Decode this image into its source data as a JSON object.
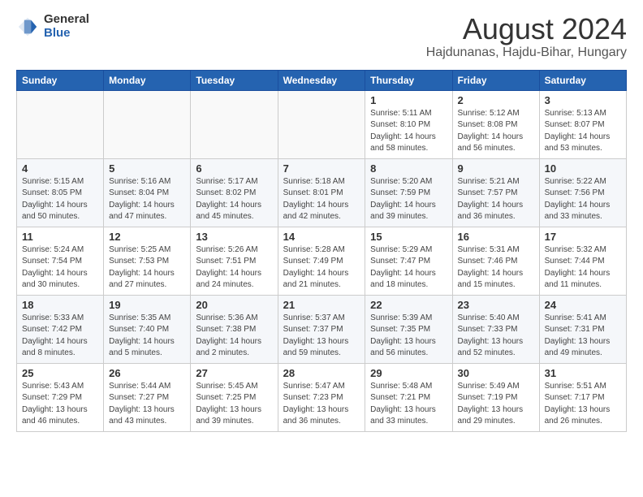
{
  "header": {
    "logo_general": "General",
    "logo_blue": "Blue",
    "month_title": "August 2024",
    "location": "Hajdunanas, Hajdu-Bihar, Hungary"
  },
  "weekdays": [
    "Sunday",
    "Monday",
    "Tuesday",
    "Wednesday",
    "Thursday",
    "Friday",
    "Saturday"
  ],
  "weeks": [
    [
      {
        "day": "",
        "info": ""
      },
      {
        "day": "",
        "info": ""
      },
      {
        "day": "",
        "info": ""
      },
      {
        "day": "",
        "info": ""
      },
      {
        "day": "1",
        "info": "Sunrise: 5:11 AM\nSunset: 8:10 PM\nDaylight: 14 hours and 58 minutes."
      },
      {
        "day": "2",
        "info": "Sunrise: 5:12 AM\nSunset: 8:08 PM\nDaylight: 14 hours and 56 minutes."
      },
      {
        "day": "3",
        "info": "Sunrise: 5:13 AM\nSunset: 8:07 PM\nDaylight: 14 hours and 53 minutes."
      }
    ],
    [
      {
        "day": "4",
        "info": "Sunrise: 5:15 AM\nSunset: 8:05 PM\nDaylight: 14 hours and 50 minutes."
      },
      {
        "day": "5",
        "info": "Sunrise: 5:16 AM\nSunset: 8:04 PM\nDaylight: 14 hours and 47 minutes."
      },
      {
        "day": "6",
        "info": "Sunrise: 5:17 AM\nSunset: 8:02 PM\nDaylight: 14 hours and 45 minutes."
      },
      {
        "day": "7",
        "info": "Sunrise: 5:18 AM\nSunset: 8:01 PM\nDaylight: 14 hours and 42 minutes."
      },
      {
        "day": "8",
        "info": "Sunrise: 5:20 AM\nSunset: 7:59 PM\nDaylight: 14 hours and 39 minutes."
      },
      {
        "day": "9",
        "info": "Sunrise: 5:21 AM\nSunset: 7:57 PM\nDaylight: 14 hours and 36 minutes."
      },
      {
        "day": "10",
        "info": "Sunrise: 5:22 AM\nSunset: 7:56 PM\nDaylight: 14 hours and 33 minutes."
      }
    ],
    [
      {
        "day": "11",
        "info": "Sunrise: 5:24 AM\nSunset: 7:54 PM\nDaylight: 14 hours and 30 minutes."
      },
      {
        "day": "12",
        "info": "Sunrise: 5:25 AM\nSunset: 7:53 PM\nDaylight: 14 hours and 27 minutes."
      },
      {
        "day": "13",
        "info": "Sunrise: 5:26 AM\nSunset: 7:51 PM\nDaylight: 14 hours and 24 minutes."
      },
      {
        "day": "14",
        "info": "Sunrise: 5:28 AM\nSunset: 7:49 PM\nDaylight: 14 hours and 21 minutes."
      },
      {
        "day": "15",
        "info": "Sunrise: 5:29 AM\nSunset: 7:47 PM\nDaylight: 14 hours and 18 minutes."
      },
      {
        "day": "16",
        "info": "Sunrise: 5:31 AM\nSunset: 7:46 PM\nDaylight: 14 hours and 15 minutes."
      },
      {
        "day": "17",
        "info": "Sunrise: 5:32 AM\nSunset: 7:44 PM\nDaylight: 14 hours and 11 minutes."
      }
    ],
    [
      {
        "day": "18",
        "info": "Sunrise: 5:33 AM\nSunset: 7:42 PM\nDaylight: 14 hours and 8 minutes."
      },
      {
        "day": "19",
        "info": "Sunrise: 5:35 AM\nSunset: 7:40 PM\nDaylight: 14 hours and 5 minutes."
      },
      {
        "day": "20",
        "info": "Sunrise: 5:36 AM\nSunset: 7:38 PM\nDaylight: 14 hours and 2 minutes."
      },
      {
        "day": "21",
        "info": "Sunrise: 5:37 AM\nSunset: 7:37 PM\nDaylight: 13 hours and 59 minutes."
      },
      {
        "day": "22",
        "info": "Sunrise: 5:39 AM\nSunset: 7:35 PM\nDaylight: 13 hours and 56 minutes."
      },
      {
        "day": "23",
        "info": "Sunrise: 5:40 AM\nSunset: 7:33 PM\nDaylight: 13 hours and 52 minutes."
      },
      {
        "day": "24",
        "info": "Sunrise: 5:41 AM\nSunset: 7:31 PM\nDaylight: 13 hours and 49 minutes."
      }
    ],
    [
      {
        "day": "25",
        "info": "Sunrise: 5:43 AM\nSunset: 7:29 PM\nDaylight: 13 hours and 46 minutes."
      },
      {
        "day": "26",
        "info": "Sunrise: 5:44 AM\nSunset: 7:27 PM\nDaylight: 13 hours and 43 minutes."
      },
      {
        "day": "27",
        "info": "Sunrise: 5:45 AM\nSunset: 7:25 PM\nDaylight: 13 hours and 39 minutes."
      },
      {
        "day": "28",
        "info": "Sunrise: 5:47 AM\nSunset: 7:23 PM\nDaylight: 13 hours and 36 minutes."
      },
      {
        "day": "29",
        "info": "Sunrise: 5:48 AM\nSunset: 7:21 PM\nDaylight: 13 hours and 33 minutes."
      },
      {
        "day": "30",
        "info": "Sunrise: 5:49 AM\nSunset: 7:19 PM\nDaylight: 13 hours and 29 minutes."
      },
      {
        "day": "31",
        "info": "Sunrise: 5:51 AM\nSunset: 7:17 PM\nDaylight: 13 hours and 26 minutes."
      }
    ]
  ]
}
